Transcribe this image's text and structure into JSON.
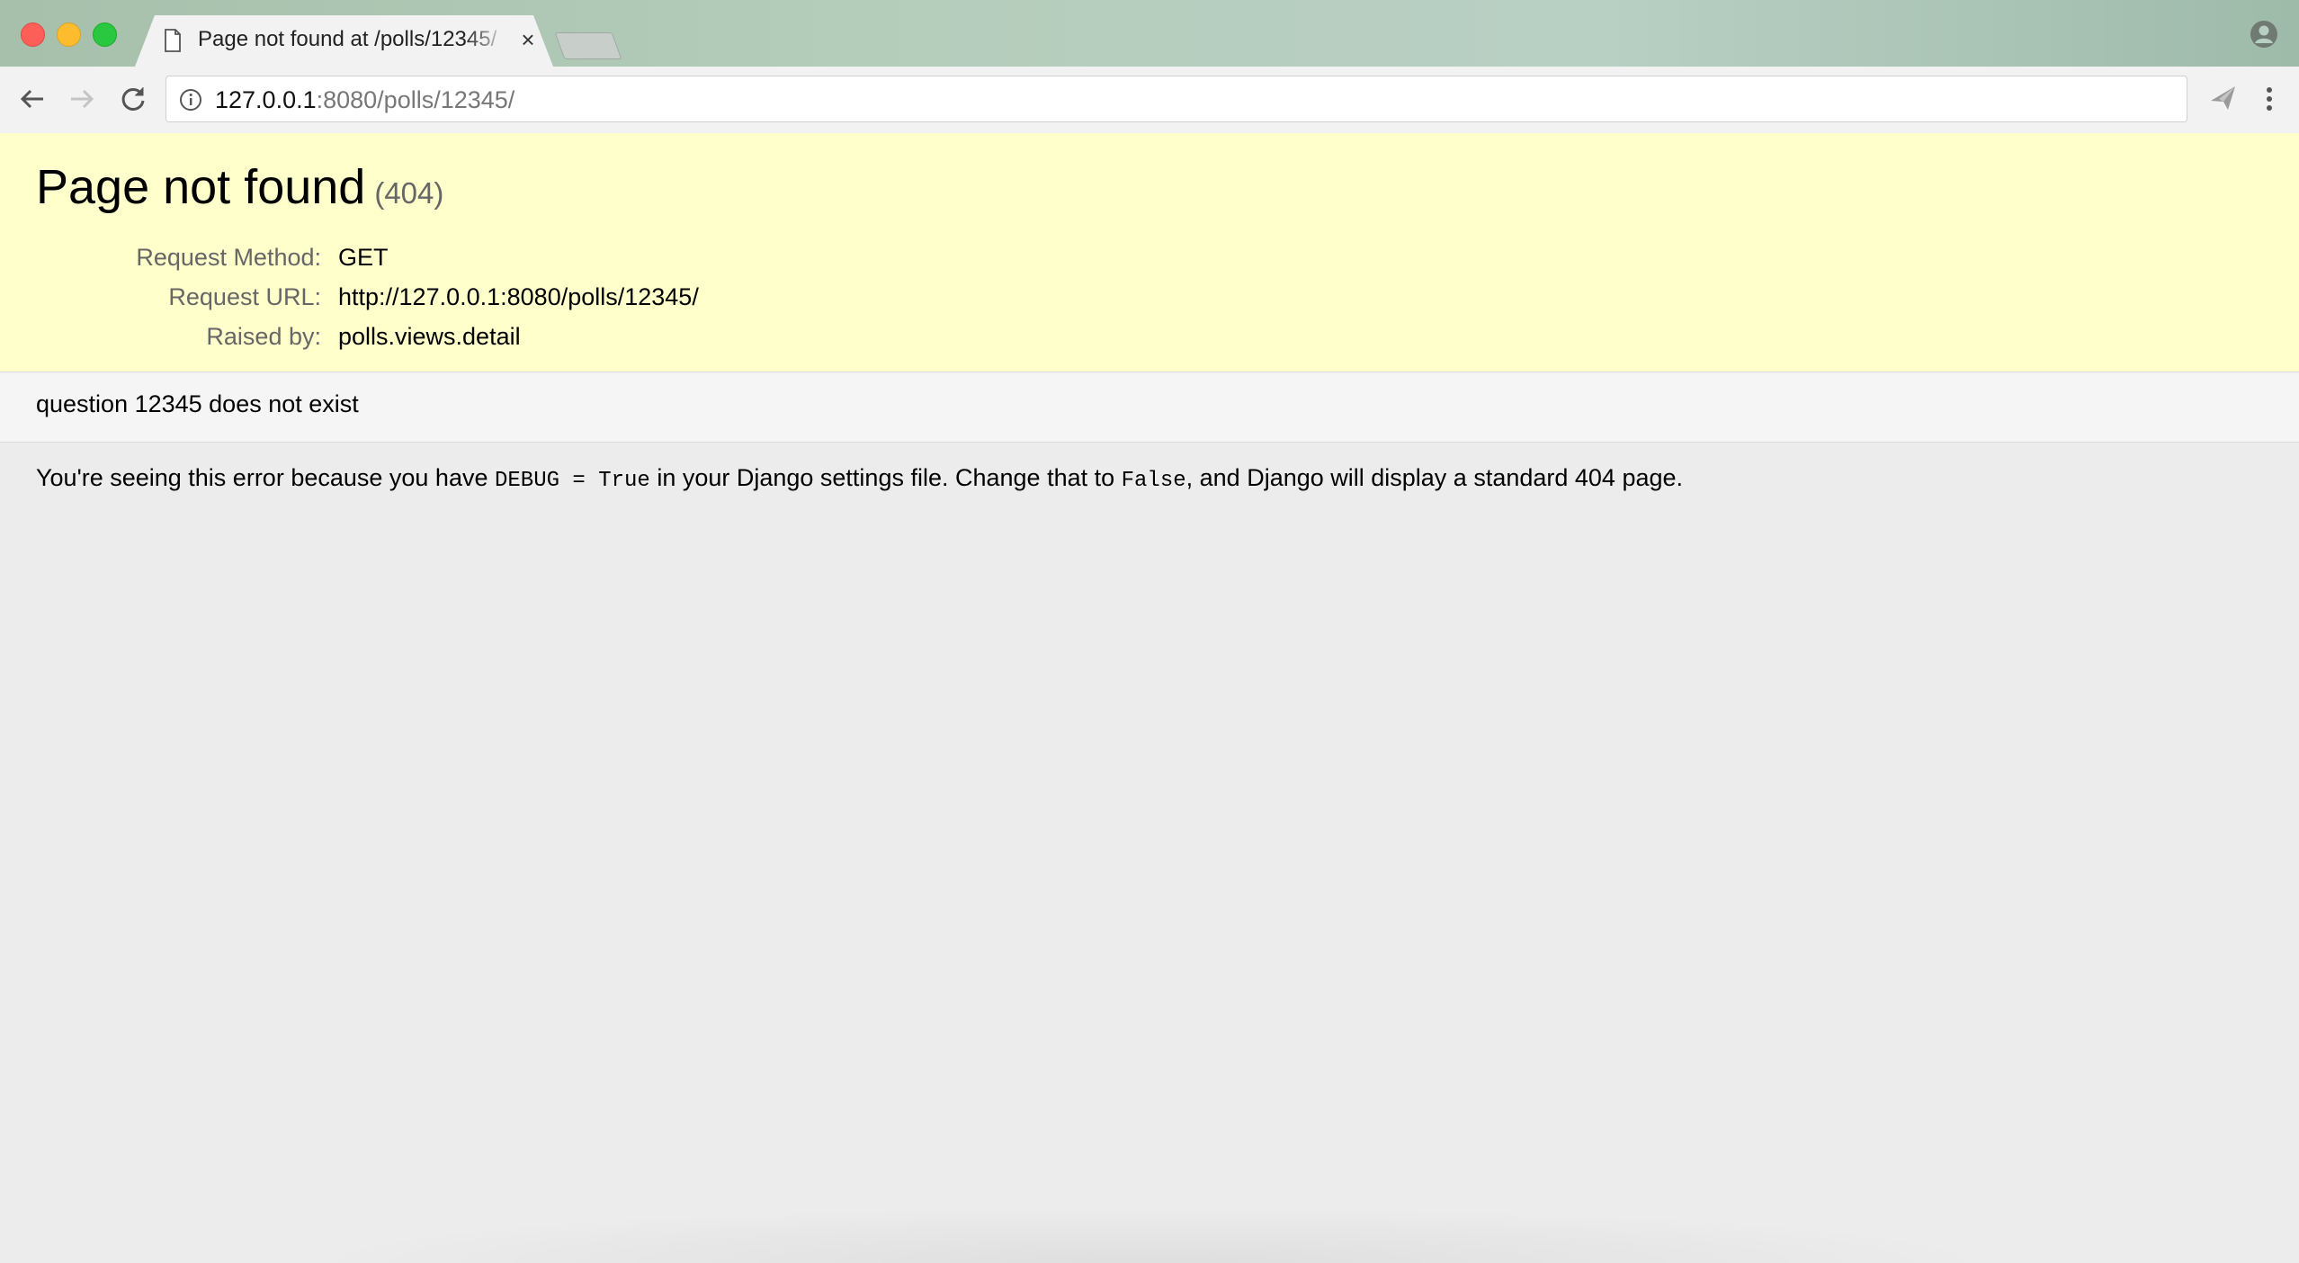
{
  "browser": {
    "tab_title": "Page not found at /polls/12345/",
    "tab_close_symbol": "×",
    "url_host": "127.0.0.1",
    "url_rest": ":8080/polls/12345/"
  },
  "error": {
    "title": "Page not found",
    "status": "(404)",
    "meta": [
      {
        "label": "Request Method:",
        "value": "GET"
      },
      {
        "label": "Request URL:",
        "value": "http://127.0.0.1:8080/polls/12345/"
      },
      {
        "label": "Raised by:",
        "value": "polls.views.detail"
      }
    ],
    "info": "question 12345 does not exist",
    "explanation": {
      "part1": "You're seeing this error because you have ",
      "code1": "DEBUG = True",
      "part2": " in your Django settings file. Change that to ",
      "code2": "False",
      "part3": ", and Django will display a standard 404 page."
    }
  },
  "colors": {
    "summary_bg": "#ffffcc",
    "info_bg": "#f5f5f5",
    "page_bg": "#ececec"
  }
}
